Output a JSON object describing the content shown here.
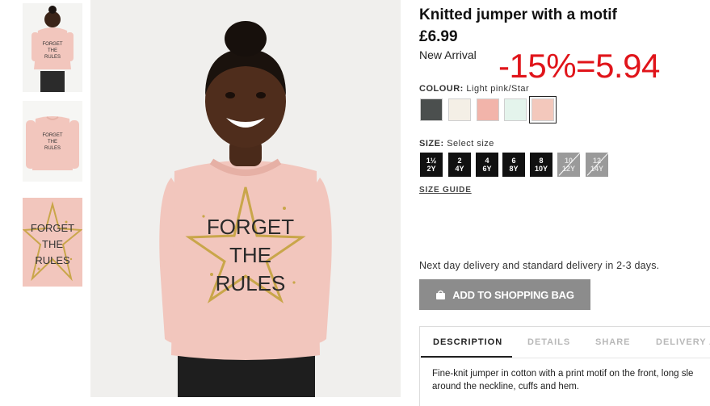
{
  "product": {
    "title": "Knitted jumper with a motif",
    "price": "£6.99",
    "badge": "New Arrival",
    "promo": "-15%=5.94"
  },
  "image_motif": [
    "FORGET",
    "THE",
    "RULES"
  ],
  "colour": {
    "label": "COLOUR:",
    "selected": "Light pink/Star",
    "swatches": [
      "#4b4f4e",
      "#f4efe6",
      "#f2b4aa",
      "#e4f4ec",
      "#f3c8bc"
    ]
  },
  "size": {
    "label": "SIZE:",
    "placeholder": "Select size",
    "options": [
      {
        "top": "1½",
        "bottom": "2Y",
        "available": true
      },
      {
        "top": "2",
        "bottom": "4Y",
        "available": true
      },
      {
        "top": "4",
        "bottom": "6Y",
        "available": true
      },
      {
        "top": "6",
        "bottom": "8Y",
        "available": true
      },
      {
        "top": "8",
        "bottom": "10Y",
        "available": true
      },
      {
        "top": "10",
        "bottom": "12Y",
        "available": false
      },
      {
        "top": "12",
        "bottom": "14Y",
        "available": false
      }
    ],
    "guide": "SIZE GUIDE"
  },
  "delivery": "Next day delivery and standard delivery in 2-3 days.",
  "add_to_bag": "ADD TO SHOPPING BAG",
  "tabs": [
    "DESCRIPTION",
    "DETAILS",
    "SHARE",
    "DELIVERY A"
  ],
  "description": "Fine-knit jumper in cotton with a print motif on the front, long sle around the neckline, cuffs and hem.",
  "colors": {
    "promo": "#e0141a",
    "button": "#8c8c8c",
    "jumper": "#f2c6bd",
    "star": "#c9a64a"
  }
}
